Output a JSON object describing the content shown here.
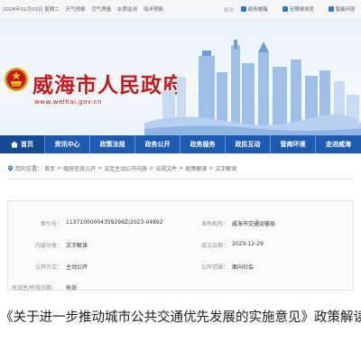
{
  "topbar": {
    "date": "2024年01月03日 星期二",
    "links": [
      "天气预报",
      "空气质量",
      "水质监测",
      "海洋预报"
    ],
    "lang": "繁体",
    "quick": [
      {
        "label": "政务邮箱",
        "icon": "mail-icon"
      },
      {
        "label": "无障碍浏览",
        "icon": "accessibility-icon"
      },
      {
        "label": "智能问答",
        "icon": "chat-icon"
      }
    ]
  },
  "header": {
    "title": "威海市人民政府",
    "url": "www.weihai.gov.cn"
  },
  "nav": {
    "items": [
      "首页",
      "资讯中心",
      "政策法规",
      "政务公开",
      "政务服务",
      "政民互动",
      "营商环境",
      "走进威海"
    ]
  },
  "breadcrumb": {
    "prefix": "您的位置：",
    "items": [
      "首页",
      "政府信息公开",
      "法定主动公开内容",
      "法规文件",
      "政策解读",
      "文字解读"
    ],
    "separator": " > "
  },
  "info": {
    "index_label": "索引号：",
    "index_value": "11371000004359299Z/2023-04892",
    "publisher_label": "发布机构：",
    "publisher_value": "威海市交通运输局",
    "category_label": "内容分类：",
    "category_value": "文字解读",
    "date_label": "成文日期：",
    "date_value": "2023-12-29",
    "open_mode_label": "公开方式：",
    "open_mode_value": "主动公开",
    "scope_label": "公开范围：",
    "scope_value": "面向社会",
    "validity_label": "有效性/有效日期：",
    "validity_value": "有效"
  },
  "article": {
    "title": "《关于进一步推动城市公共交通优先发展的实施意见》政策解读"
  },
  "colors": {
    "nav": "#1d5ab0",
    "title_red": "#c41c1c"
  }
}
